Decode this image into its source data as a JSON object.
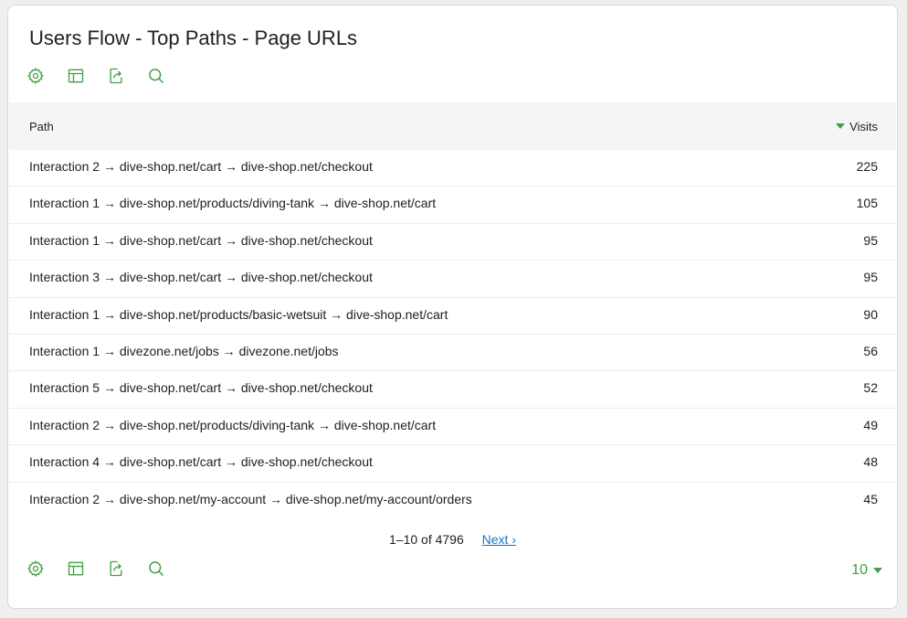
{
  "report": {
    "title": "Users Flow - Top Paths - Page URLs"
  },
  "toolbar_icons": [
    "gear-icon",
    "table-icon",
    "export-icon",
    "search-icon"
  ],
  "colors": {
    "accent": "#43a047",
    "link": "#1a73c7",
    "header_bg": "#f5f5f5"
  },
  "table": {
    "columns": {
      "path": "Path",
      "visits": "Visits"
    },
    "rows": [
      {
        "path": "Interaction 2 → dive-shop.net/cart → dive-shop.net/checkout",
        "visits": "225"
      },
      {
        "path": "Interaction 1 → dive-shop.net/products/diving-tank → dive-shop.net/cart",
        "visits": "105"
      },
      {
        "path": "Interaction 1 → dive-shop.net/cart → dive-shop.net/checkout",
        "visits": "95"
      },
      {
        "path": "Interaction 3 → dive-shop.net/cart → dive-shop.net/checkout",
        "visits": "95"
      },
      {
        "path": "Interaction 1 → dive-shop.net/products/basic-wetsuit → dive-shop.net/cart",
        "visits": "90"
      },
      {
        "path": "Interaction 1 → divezone.net/jobs → divezone.net/jobs",
        "visits": "56"
      },
      {
        "path": "Interaction 5 → dive-shop.net/cart → dive-shop.net/checkout",
        "visits": "52"
      },
      {
        "path": "Interaction 2 → dive-shop.net/products/diving-tank → dive-shop.net/cart",
        "visits": "49"
      },
      {
        "path": "Interaction 4 → dive-shop.net/cart → dive-shop.net/checkout",
        "visits": "48"
      },
      {
        "path": "Interaction 2 → dive-shop.net/my-account → dive-shop.net/my-account/orders",
        "visits": "45"
      }
    ]
  },
  "pagination": {
    "info": "1–10 of 4796",
    "next_label": "Next ›",
    "limit": "10"
  }
}
